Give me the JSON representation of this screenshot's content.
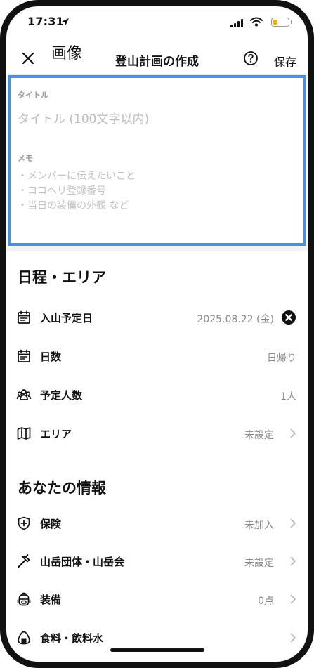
{
  "status_bar": {
    "time": "17:31"
  },
  "header": {
    "overlay_label": "画像",
    "title": "登山計画の作成",
    "save_label": "保存"
  },
  "form": {
    "title_label": "タイトル",
    "title_placeholder": "タイトル (100文字以内)",
    "memo_label": "メモ",
    "memo_placeholder_lines": [
      "・メンバーに伝えたいこと",
      "・ココヘリ登録番号",
      "・当日の装備の外観 など"
    ]
  },
  "schedule_section": {
    "title": "日程・エリア",
    "rows": [
      {
        "label": "入山予定日",
        "value": "2025.08.22 (金)",
        "icon": "calendar-icon"
      },
      {
        "label": "日数",
        "value": "日帰り",
        "icon": "calendar-icon"
      },
      {
        "label": "予定人数",
        "value": "1人",
        "icon": "people-icon"
      },
      {
        "label": "エリア",
        "value": "未設定",
        "icon": "map-icon"
      }
    ]
  },
  "info_section": {
    "title": "あなたの情報",
    "rows": [
      {
        "label": "保険",
        "value": "未加入",
        "icon": "shield-plus-icon"
      },
      {
        "label": "山岳団体・山岳会",
        "value": "未設定",
        "icon": "ice-axe-icon"
      },
      {
        "label": "装備",
        "value": "0点",
        "icon": "backpack-icon"
      },
      {
        "label": "食料・飲料水",
        "value": "",
        "icon": "onigiri-icon"
      }
    ]
  },
  "colors": {
    "highlight_border": "#4a90e2",
    "battery": "#f2b400"
  }
}
